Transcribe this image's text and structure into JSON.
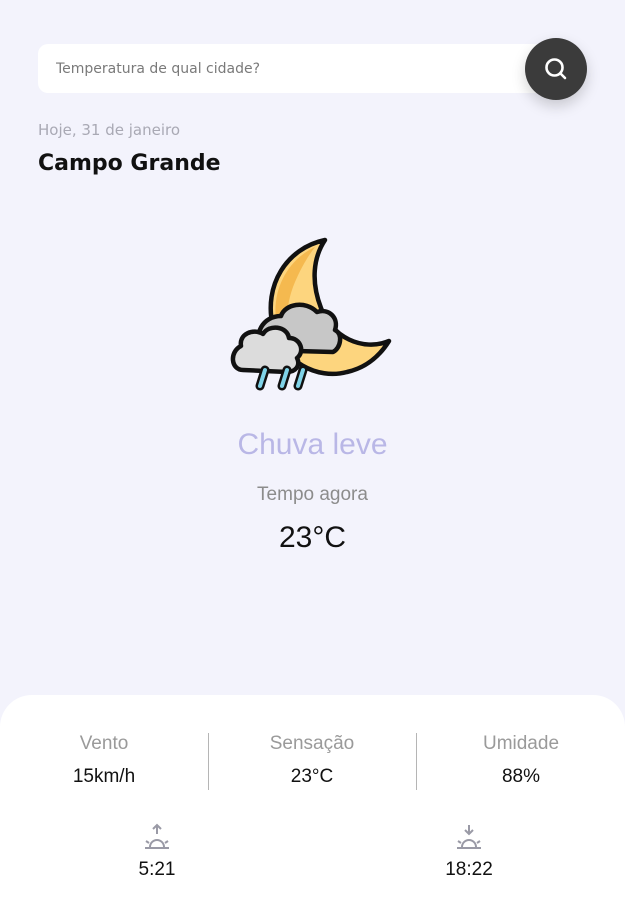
{
  "search": {
    "placeholder": "Temperatura de qual cidade?",
    "button_icon": "search-icon"
  },
  "location": {
    "date": "Hoje, 31 de janeiro",
    "city": "Campo Grande"
  },
  "current": {
    "icon": "moon-cloud-rain-icon",
    "condition": "Chuva leve",
    "label": "Tempo agora",
    "temperature": "23°C"
  },
  "details": {
    "wind": {
      "label": "Vento",
      "value": "15km/h"
    },
    "feels_like": {
      "label": "Sensação",
      "value": "23°C"
    },
    "humidity": {
      "label": "Umidade",
      "value": "88%"
    }
  },
  "sun": {
    "sunrise": {
      "icon": "sunrise-icon",
      "time": "5:21"
    },
    "sunset": {
      "icon": "sunset-icon",
      "time": "18:22"
    }
  },
  "colors": {
    "background": "#f3f3fc",
    "accent": "#b9b7e6",
    "search_button": "#3b3b3b",
    "moon": "#fdd57e"
  }
}
